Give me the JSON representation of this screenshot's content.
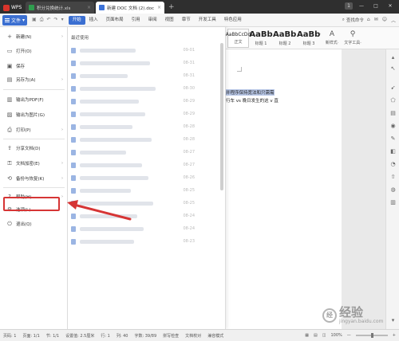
{
  "titlebar": {
    "wps_label": "WPS",
    "tabs": [
      {
        "label": "积分兑换统计.xls",
        "close": "×",
        "kind": "xls"
      },
      {
        "label": "新建 DOC 文档 (2).doc",
        "close": "×",
        "kind": "doc"
      }
    ],
    "add_tab": "+",
    "window_badge": "1",
    "minimize": "—",
    "maximize": "□",
    "close": "✕"
  },
  "menubar": {
    "file_label": "文件",
    "tabs": [
      "开始",
      "插入",
      "页面布局",
      "引用",
      "审阅",
      "视图",
      "章节",
      "开发工具",
      "特色应用"
    ],
    "active_tab": "开始",
    "search_label": "查找命令",
    "right_icons": [
      "⌂",
      "✉",
      "☺",
      "︿"
    ]
  },
  "ribbon": {
    "normal_style": {
      "sample": "AaBbCcDd",
      "label": "正文"
    },
    "heading1": {
      "sample": "AaBb",
      "label": "标题 1"
    },
    "heading2": {
      "sample": "AaBb(",
      "label": "标题 2"
    },
    "heading3": {
      "sample": "AaBbCc",
      "label": "标题 3"
    },
    "new_style": {
      "glyph": "A",
      "label": "新样式·"
    },
    "text_tool": {
      "glyph": "⚲",
      "label": "文字工具·"
    }
  },
  "document": {
    "line1": "并程序保持宽法和只需需",
    "line2": "行车 vs 晚日发生的这 v 直"
  },
  "file_menu": {
    "items": [
      {
        "label": "新建(N)",
        "icon": "+",
        "arrow": "›"
      },
      {
        "label": "打开(O)",
        "icon": "▭",
        "arrow": ""
      },
      {
        "label": "保存",
        "icon": "▣",
        "arrow": ""
      },
      {
        "label": "另存为(A)",
        "icon": "▤",
        "arrow": "›"
      },
      {
        "label": "输出为PDF(F)",
        "icon": "▥",
        "arrow": ""
      },
      {
        "label": "输出为图片(G)",
        "icon": "▨",
        "arrow": ""
      },
      {
        "label": "打印(P)",
        "icon": "⎙",
        "arrow": "›"
      },
      {
        "label": "分享文档(D)",
        "icon": "⇪",
        "arrow": ""
      },
      {
        "label": "文档加密(E)",
        "icon": "⚿",
        "arrow": "›"
      },
      {
        "label": "备份与恢复(K)",
        "icon": "⟲",
        "arrow": "›"
      },
      {
        "label": "帮助(H)",
        "icon": "?",
        "arrow": "›"
      },
      {
        "label": "选项(L)",
        "icon": "⚙",
        "arrow": ""
      },
      {
        "label": "退出(Q)",
        "icon": "⏻",
        "arrow": ""
      }
    ]
  },
  "recent": {
    "title": "最近使用",
    "items": [
      {
        "time": "09-01"
      },
      {
        "time": "08-31"
      },
      {
        "time": "08-31"
      },
      {
        "time": "08-30"
      },
      {
        "time": "08-29"
      },
      {
        "time": "08-29"
      },
      {
        "time": "08-28"
      },
      {
        "time": "08-28"
      },
      {
        "time": "08-27"
      },
      {
        "time": "08-27"
      },
      {
        "time": "08-26"
      },
      {
        "time": "08-25"
      },
      {
        "time": "08-25"
      },
      {
        "time": "08-24"
      },
      {
        "time": "08-24"
      },
      {
        "time": "08-23"
      }
    ]
  },
  "statusbar": {
    "page_num": "页码: 1",
    "pages": "页面: 1/1",
    "section": "节: 1/1",
    "setting": "设置值: 2.5厘米",
    "row": "行: 1",
    "col": "列: 40",
    "words": "字数: 39/89",
    "spell": "拼写检查",
    "proof": "文档校对",
    "mode": "兼容模式",
    "zoom": "100%",
    "zoom_minus": "—",
    "zoom_plus": "+"
  },
  "watermark": {
    "badge": "经",
    "big": "经验",
    "small": "jingyan.baidu.com"
  },
  "colors": {
    "accent": "#3b6fd1",
    "highlight_box": "#d63535",
    "arrow": "#d63535"
  }
}
